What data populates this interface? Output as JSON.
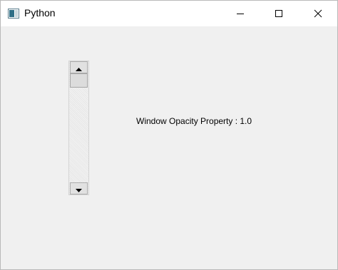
{
  "window": {
    "title": "Python"
  },
  "scrollbar": {
    "orientation": "vertical",
    "value_fraction": 0.0
  },
  "main": {
    "opacity_label": "Window Opacity Property : 1.0"
  },
  "icons": {
    "app": "python-window-icon",
    "minimize": "minimize-icon",
    "maximize": "maximize-icon",
    "close": "close-icon",
    "scroll_up": "arrow-up-icon",
    "scroll_down": "arrow-down-icon"
  }
}
